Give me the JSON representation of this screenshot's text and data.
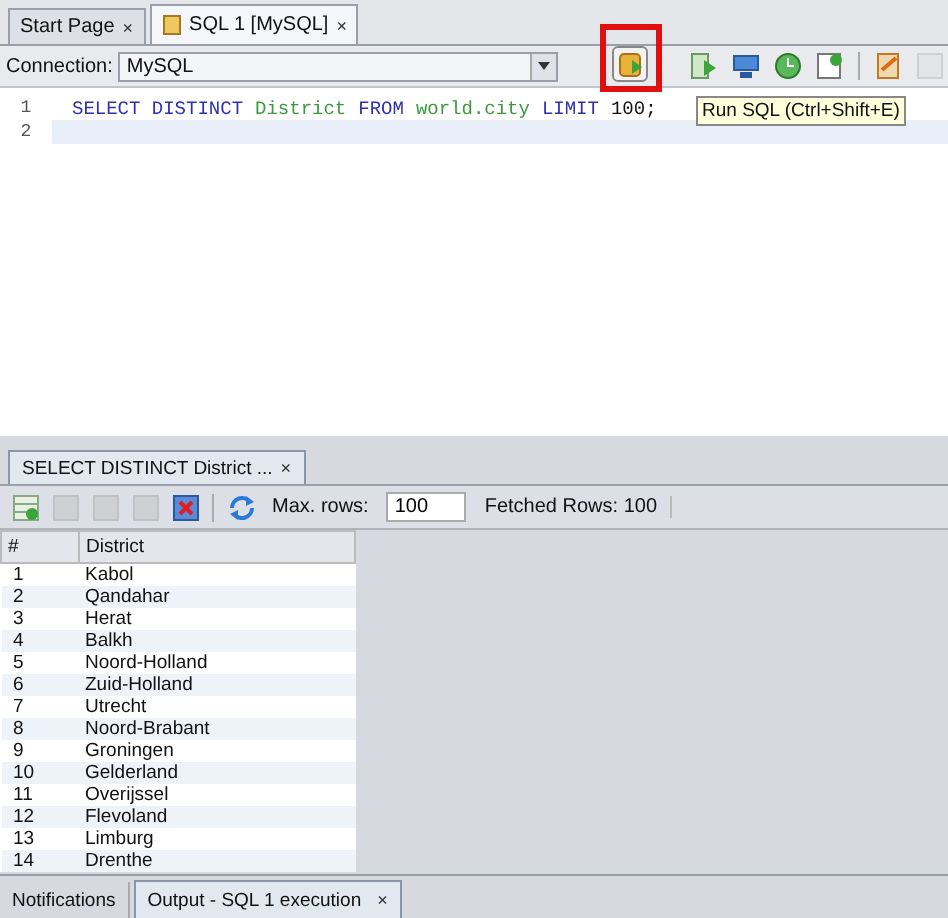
{
  "editor_tabs": [
    {
      "label": "Start Page",
      "close": "×",
      "selected": false,
      "has_icon": false
    },
    {
      "label": "SQL 1 [MySQL]",
      "close": "×",
      "selected": true,
      "has_icon": true
    }
  ],
  "connection": {
    "label": "Connection:",
    "value": "MySQL"
  },
  "toolbar": [
    {
      "highlighted": true,
      "disabled": false
    },
    {
      "highlighted": false,
      "disabled": false
    },
    {
      "highlighted": false,
      "disabled": false
    },
    {
      "highlighted": false,
      "disabled": false
    },
    {
      "highlighted": false,
      "disabled": false
    },
    {
      "highlighted": false,
      "disabled": false
    },
    {
      "highlighted": false,
      "disabled": true
    }
  ],
  "tooltip": "Run SQL (Ctrl+Shift+E)",
  "editor": {
    "lines": [
      {
        "number": "1",
        "current": false,
        "tokens": [
          {
            "text": "SELECT DISTINCT",
            "kind": "keyword"
          },
          {
            "text": "District",
            "kind": "identifier"
          },
          {
            "text": "FROM",
            "kind": "keyword"
          },
          {
            "text": "world.city",
            "kind": "identifier"
          },
          {
            "text": "LIMIT",
            "kind": "keyword"
          },
          {
            "text": "100;",
            "kind": "literal"
          }
        ]
      },
      {
        "number": "2",
        "current": true
      }
    ]
  },
  "result_tabs": [
    {
      "label": "SELECT DISTINCT District ...",
      "close": "×",
      "selected": true
    }
  ],
  "result_toolbar": {
    "buttons": [
      {
        "disabled": false
      },
      {
        "disabled": true
      },
      {
        "disabled": true
      },
      {
        "disabled": true
      },
      {
        "disabled": false
      },
      {
        "disabled": false
      }
    ],
    "max_rows_label": "Max. rows:",
    "max_rows": "100",
    "fetched": "Fetched Rows: 100"
  },
  "table": {
    "columns": [
      "#",
      "District"
    ],
    "rows": [
      [
        "1",
        "Kabol"
      ],
      [
        "2",
        "Qandahar"
      ],
      [
        "3",
        "Herat"
      ],
      [
        "4",
        "Balkh"
      ],
      [
        "5",
        "Noord-Holland"
      ],
      [
        "6",
        "Zuid-Holland"
      ],
      [
        "7",
        "Utrecht"
      ],
      [
        "8",
        "Noord-Brabant"
      ],
      [
        "9",
        "Groningen"
      ],
      [
        "10",
        "Gelderland"
      ],
      [
        "11",
        "Overijssel"
      ],
      [
        "12",
        "Flevoland"
      ],
      [
        "13",
        "Limburg"
      ],
      [
        "14",
        "Drenthe"
      ]
    ]
  },
  "bottom_tabs": [
    {
      "label": "Notifications",
      "selected": false
    },
    {
      "label": "Output - SQL 1 execution",
      "close": "×",
      "selected": true
    }
  ]
}
